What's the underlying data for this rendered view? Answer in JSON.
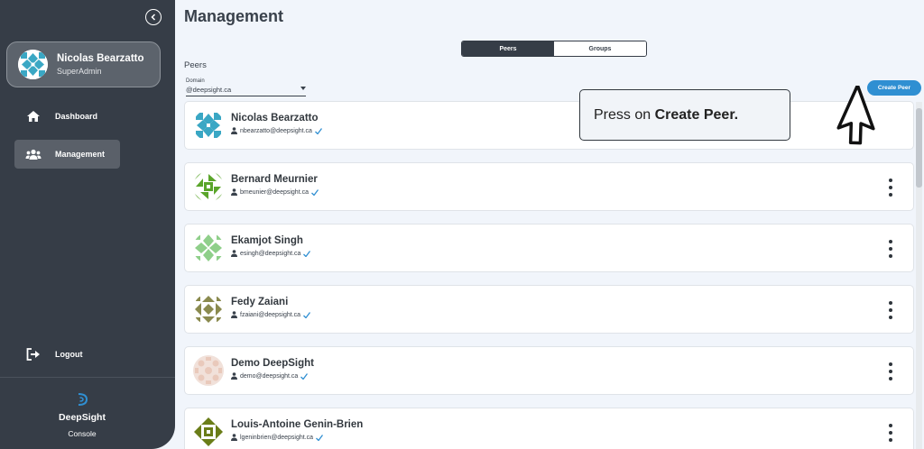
{
  "sidebar": {
    "user": {
      "name": "Nicolas Bearzatto",
      "role": "SuperAdmin"
    },
    "nav": [
      {
        "label": "Dashboard",
        "icon": "home-icon"
      },
      {
        "label": "Management",
        "icon": "users-icon",
        "active": true
      }
    ],
    "logout_label": "Logout",
    "brand_name": "DeepSight",
    "brand_sub": "Console"
  },
  "main": {
    "title": "Management",
    "toggle": {
      "peers": "Peers",
      "groups": "Groups",
      "active": "Peers"
    },
    "section_label": "Peers",
    "domain": {
      "label": "Domain",
      "value": "@deepsight.ca"
    },
    "create_button": "Create Peer",
    "peers": [
      {
        "name": "Nicolas Bearzatto",
        "email": "nbearzatto@deepsight.ca"
      },
      {
        "name": "Bernard Meurnier",
        "email": "bmeunier@deepsight.ca"
      },
      {
        "name": "Ekamjot Singh",
        "email": "esingh@deepsight.ca"
      },
      {
        "name": "Fedy Zaiani",
        "email": "fzaiani@deepsight.ca"
      },
      {
        "name": "Demo DeepSight",
        "email": "demo@deepsight.ca"
      },
      {
        "name": "Louis-Antoine Genin-Brien",
        "email": "lgeninbrien@deepsight.ca"
      }
    ]
  },
  "tooltip": {
    "prefix": "Press on ",
    "bold": "Create Peer."
  },
  "colors": {
    "sidebar_bg": "#363d47",
    "accent": "#2f8fd2",
    "verified": "#2f8fd2",
    "avatar_colors": [
      "#3aa7c4",
      "#5aa52a",
      "#8fcf8a",
      "#8a8a4e",
      "#e9c9bb",
      "#6a7d18"
    ]
  }
}
